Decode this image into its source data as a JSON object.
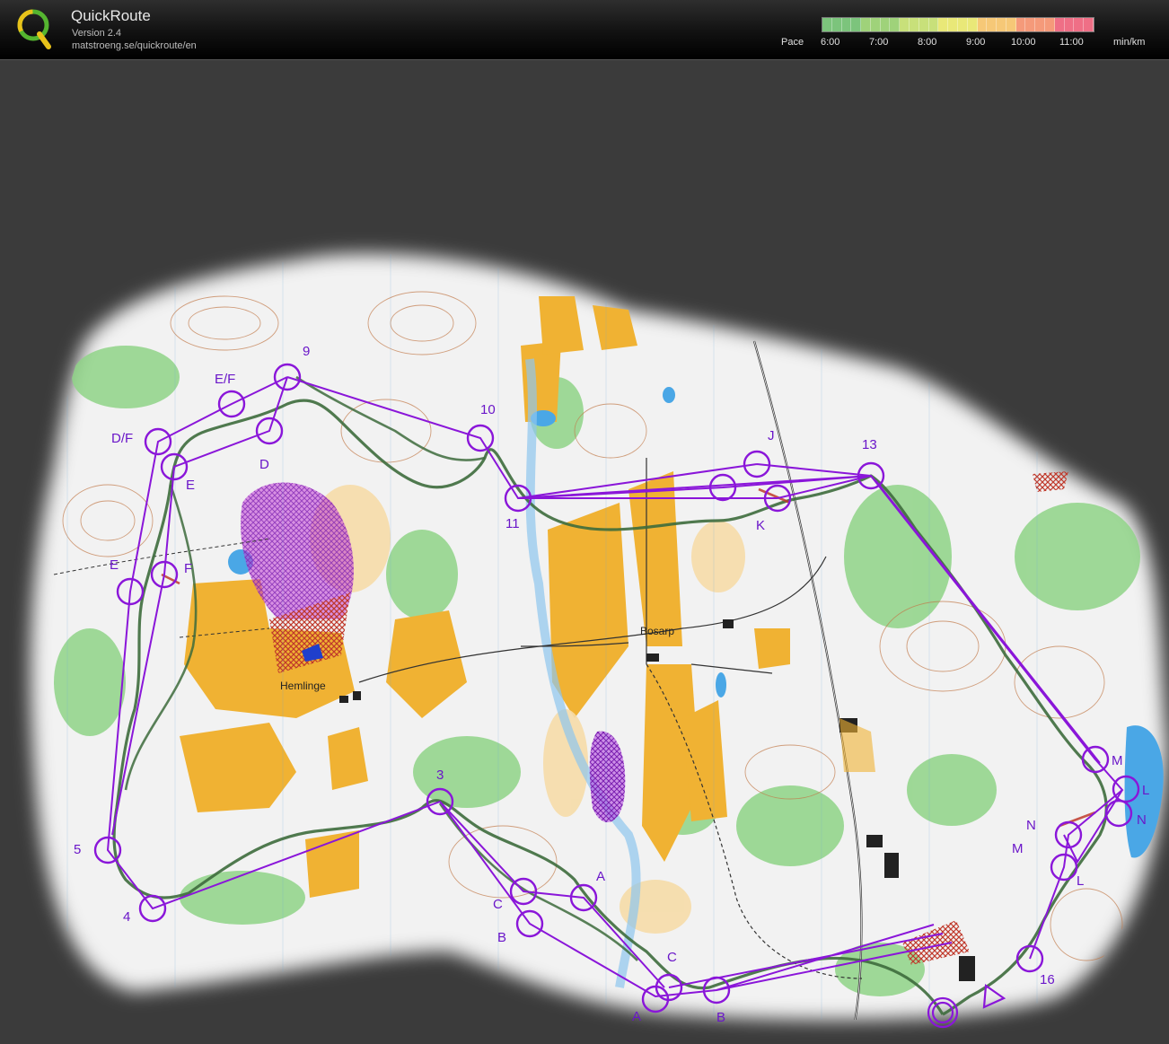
{
  "app": {
    "name": "QuickRoute",
    "version": "Version 2.4",
    "url": "matstroeng.se/quickroute/en"
  },
  "pace_scale": {
    "label": "Pace",
    "ticks": [
      "6:00",
      "7:00",
      "8:00",
      "9:00",
      "10:00",
      "11:00"
    ],
    "unit": "min/km",
    "colors": [
      "#7cc47c",
      "#9fd27a",
      "#c8e07a",
      "#e9e878",
      "#f6c877",
      "#f59a7a",
      "#ef6f86"
    ]
  },
  "map": {
    "place_names": [
      "Hemlinge",
      "Bosarp"
    ],
    "control_labels": [
      "9",
      "10",
      "11",
      "13",
      "3",
      "4",
      "5",
      "16",
      "D",
      "D/F",
      "E/F",
      "E",
      "E",
      "F",
      "J",
      "K",
      "M",
      "L",
      "N",
      "N",
      "M",
      "L",
      "A",
      "B",
      "C",
      "A",
      "B",
      "C"
    ],
    "colors": {
      "course": "#8a16d9",
      "route": "#3d6b3c",
      "forest": "#f3f3f3",
      "open_land": "#f0b233",
      "green": "#7fd17a",
      "water": "#4aa7e6",
      "background": "#3b3b3b"
    }
  }
}
